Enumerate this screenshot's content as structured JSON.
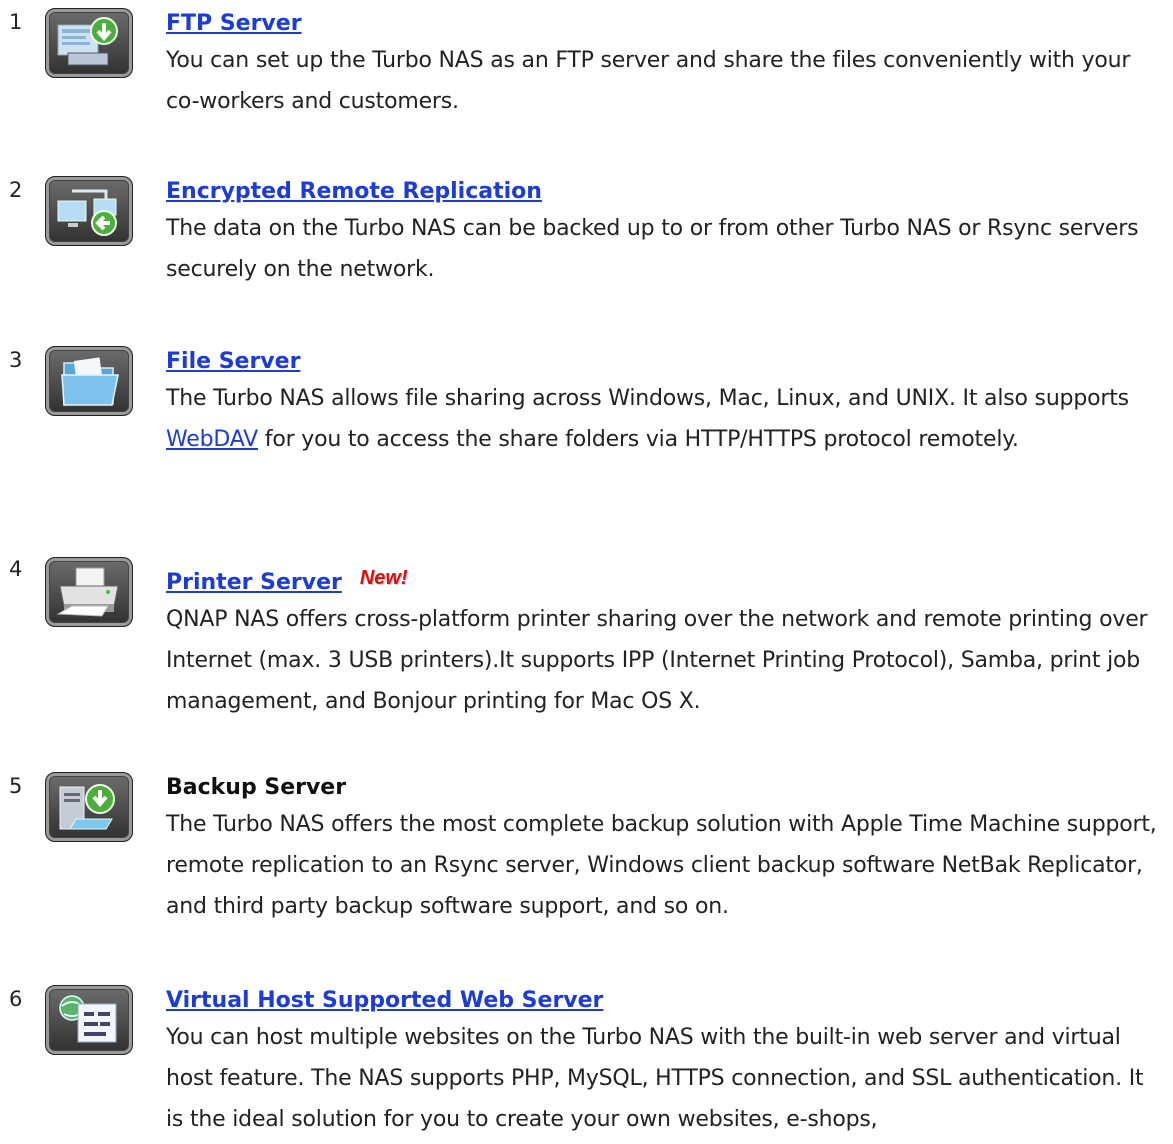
{
  "features": [
    {
      "number": "1",
      "title": "FTP Server",
      "icon": "ftp-server-icon",
      "desc": "You can set up the Turbo NAS as an FTP server and share the files conveniently with your co-workers and customers."
    },
    {
      "number": "2",
      "title": "Encrypted Remote Replication",
      "icon": "remote-replication-icon",
      "desc": "The data on the Turbo NAS can be backed up to or from other Turbo NAS or Rsync servers securely on the network."
    },
    {
      "number": "3",
      "title": "File Server",
      "icon": "folder-icon",
      "desc_before": "The Turbo NAS allows file sharing across Windows, Mac, Linux, and UNIX. It also supports ",
      "desc_link": "WebDAV",
      "desc_after": " for you to access the share folders via HTTP/HTTPS protocol remotely."
    },
    {
      "number": "4",
      "title": "Printer Server",
      "badge": "New!",
      "icon": "printer-icon",
      "desc": "QNAP NAS offers cross-platform printer sharing over the network and remote printing over Internet (max. 3 USB printers).It supports IPP (Internet Printing Protocol), Samba, print job management, and Bonjour printing for Mac OS X."
    },
    {
      "number": "5",
      "title": "Backup Server",
      "icon": "backup-server-icon",
      "desc": "The Turbo NAS offers the most complete backup solution with Apple Time Machine support, remote replication to an Rsync server, Windows client backup software NetBak Replicator, and third party backup software support, and so on."
    },
    {
      "number": "6",
      "title": "Virtual Host Supported Web Server",
      "icon": "web-server-icon",
      "desc": "You can host multiple websites on the Turbo NAS with the built-in web server and virtual host feature. The NAS supports PHP, MySQL, HTTPS connection, and SSL authentication. It is the ideal solution for you to create your own websites, e-shops,"
    }
  ]
}
